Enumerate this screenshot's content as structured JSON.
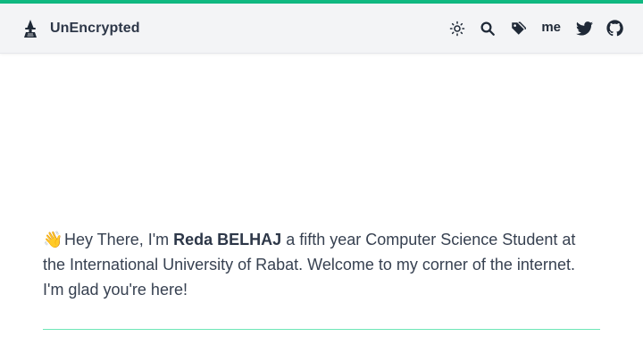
{
  "brand": {
    "name": "UnEncrypted",
    "logo_icon": "wizard-icon"
  },
  "nav": {
    "theme_icon": "sun-icon",
    "search_icon": "search-icon",
    "tags_icon": "tags-icon",
    "me_label": "me",
    "twitter_icon": "twitter-icon",
    "github_icon": "github-icon"
  },
  "intro": {
    "emoji": "👋",
    "greeting": "Hey There, I'm ",
    "name": "Reda BELHAJ",
    "text": " a fifth year Computer Science Student at the International University of Rabat. Welcome to my corner of the internet. I'm glad you're here!"
  },
  "colors": {
    "accent": "#10b981",
    "divider": "#6ee7b7",
    "navbar_bg": "#f3f4f6",
    "text": "#374151"
  }
}
